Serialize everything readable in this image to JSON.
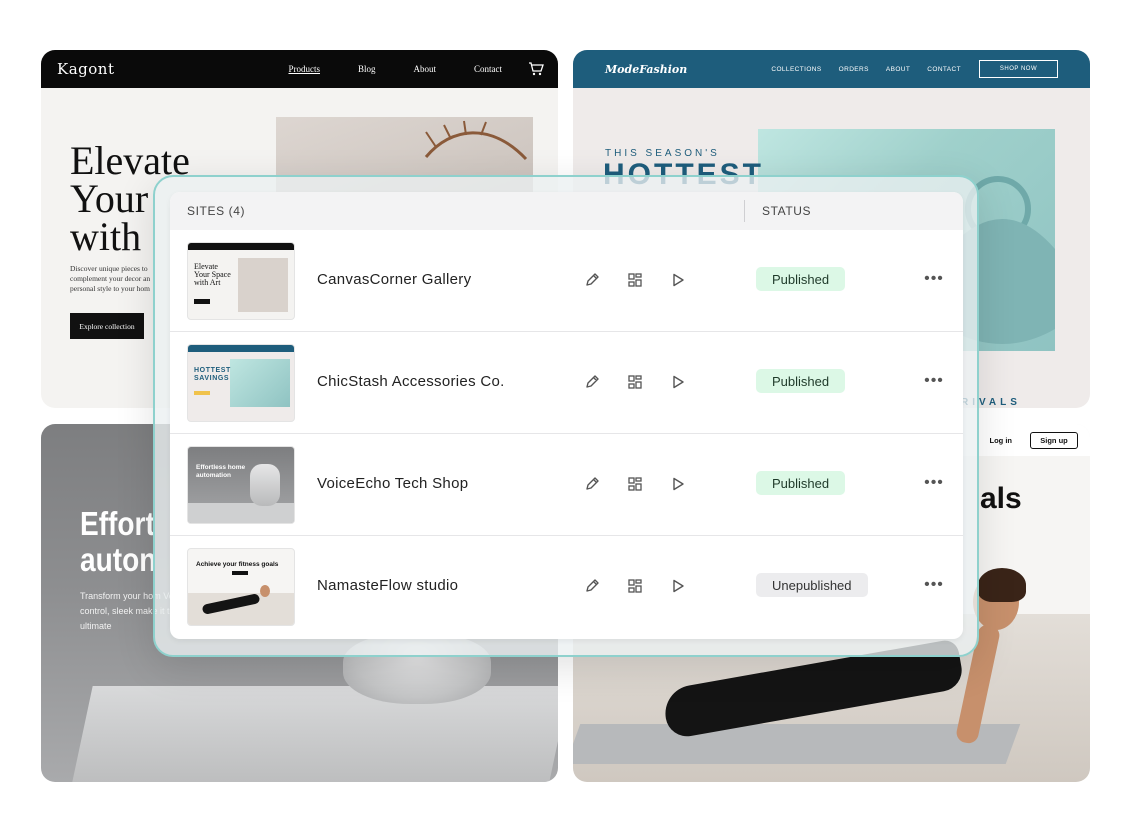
{
  "cards": {
    "kagont": {
      "logo": "Kagont",
      "nav": [
        "Products",
        "Blog",
        "About",
        "Contact"
      ],
      "headline": "Elevate\nYour\nwith",
      "description": "Discover unique pieces to complement your decor an personal style to your hom",
      "cta": "Explore collection"
    },
    "mode": {
      "logo": "ModeFashion",
      "nav": [
        "COLLECTIONS",
        "ORDERS",
        "ABOUT",
        "CONTACT"
      ],
      "shop_now": "SHOP NOW",
      "season": "THIS SEASON'S",
      "hottest": "HOTTEST",
      "arrivals": "RIVALS"
    },
    "voice": {
      "headline": "Effort\nauton",
      "description": "Transform your hom Voice control, sleek make it the ultimate"
    },
    "namaste": {
      "login": "Log in",
      "signup": "Sign up",
      "goals": "als"
    }
  },
  "table": {
    "sites_header": "SITES (4)",
    "status_header": "STATUS",
    "rows": [
      {
        "name": "CanvasCorner Gallery",
        "status": "Published",
        "thumb_text": "Elevate\nYour Space\nwith Art"
      },
      {
        "name": "ChicStash Accessories Co.",
        "status": "Published",
        "thumb_text": "HOTTEST\nSAVINGS"
      },
      {
        "name": "VoiceEcho Tech Shop",
        "status": "Published",
        "thumb_text": "Effortless home\nautomation"
      },
      {
        "name": "NamasteFlow studio",
        "status": "Unepublished",
        "thumb_text": "Achieve your fitness goals"
      }
    ],
    "more_glyph": "•••"
  },
  "colors": {
    "published_bg": "#dcf8e6",
    "unpublished_bg": "#ececee",
    "glass_border": "#8ed1cd",
    "mode_nav": "#1e5d7c"
  },
  "icons": {
    "edit": "pencil-icon",
    "dashboard": "grid-icon",
    "preview": "play-icon",
    "more": "more-horizontal-icon",
    "cart": "cart-icon"
  }
}
